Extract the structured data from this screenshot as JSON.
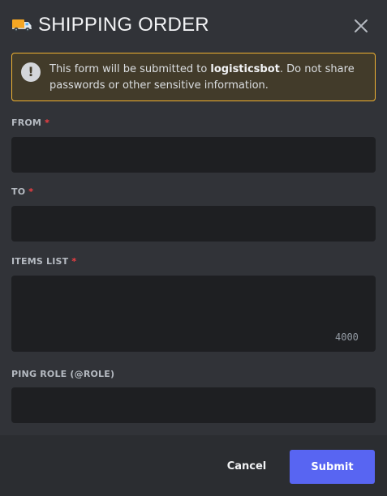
{
  "header": {
    "title": "SHIPPING ORDER",
    "icon": "delivery-truck-icon",
    "close_icon": "close-icon"
  },
  "notice": {
    "icon": "warning-icon",
    "glyph": "!",
    "text_before": "This form will be submitted to ",
    "bot_name": "logisticsbot",
    "text_after": ". Do not share passwords or other sensitive information."
  },
  "fields": {
    "from": {
      "label": "FROM",
      "required_mark": "*",
      "value": ""
    },
    "to": {
      "label": "TO",
      "required_mark": "*",
      "value": ""
    },
    "items": {
      "label": "ITEMS LIST",
      "required_mark": "*",
      "value": "",
      "char_count": "4000"
    },
    "ping_role": {
      "label": "PING ROLE (@ROLE)",
      "value": ""
    }
  },
  "footer": {
    "cancel_label": "Cancel",
    "submit_label": "Submit"
  },
  "colors": {
    "background": "#313338",
    "footer": "#2b2d31",
    "input": "#1e1f22",
    "accent": "#5865f2",
    "warning_border": "#f0b232",
    "required": "#f23f43"
  }
}
